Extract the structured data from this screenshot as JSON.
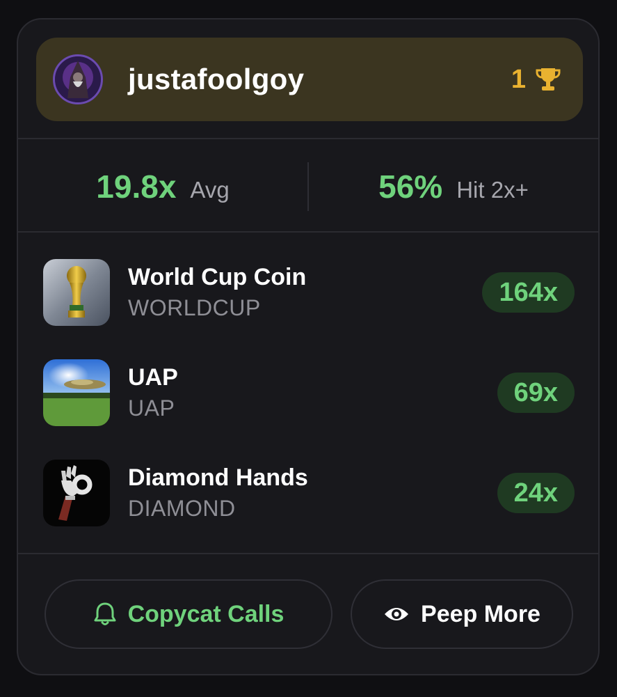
{
  "profile": {
    "username": "justafoolgoy",
    "rank": "1",
    "avatar_icon": "hooded-figure-avatar",
    "trophy_icon": "trophy-icon"
  },
  "stats": {
    "avg_value": "19.8x",
    "avg_label": "Avg",
    "hit_value": "56%",
    "hit_label": "Hit 2x+"
  },
  "coins": [
    {
      "name": "World Cup Coin",
      "ticker": "WORLDCUP",
      "multiplier": "164x",
      "image": "world-cup-trophy"
    },
    {
      "name": "UAP",
      "ticker": "UAP",
      "multiplier": "69x",
      "image": "ufo-over-field"
    },
    {
      "name": "Diamond Hands",
      "ticker": "DIAMOND",
      "multiplier": "24x",
      "image": "ok-hand-glove"
    }
  ],
  "actions": {
    "copycat_label": "Copycat Calls",
    "peep_label": "Peep More",
    "copycat_icon": "bell-icon",
    "peep_icon": "eye-icon"
  },
  "colors": {
    "accent_green": "#6fd27c",
    "gold": "#e9b230",
    "header_bg": "#3b3520",
    "card_bg": "#18181c"
  }
}
